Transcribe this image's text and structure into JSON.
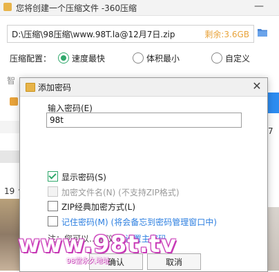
{
  "main_window": {
    "title": "您将创建一个压缩文件 -360压缩",
    "min_glyph": "—",
    "path": "D:\\压缩\\98压缩\\www.98T.la@12月7日.zip",
    "remaining": "剩余:3.6GB",
    "compress_config_label": "压缩配置：",
    "options": [
      "速度最快",
      "体积最小",
      "自定义"
    ],
    "selected_option": "速度最快",
    "partial_label_left": "智",
    "count_fragment": "19 ^",
    "right_fragment": "7"
  },
  "dialog": {
    "title": "添加密码",
    "password_label": "输入密码(E)",
    "password_value": "98t",
    "checkboxes": [
      {
        "label": "显示密码(S)",
        "checked": true,
        "disabled": false
      },
      {
        "label": "加密文件名(N) (不支持ZIP格式)",
        "checked": false,
        "disabled": true
      },
      {
        "label": "ZIP经典加密方式(L)",
        "checked": false,
        "disabled": false
      },
      {
        "label": "记住密码(M) (将会备忘到密码管理窗口中)",
        "checked": false,
        "disabled": false
      }
    ],
    "hint_prefix": "注：您可以…建议先",
    "hint_link": "设置主密码",
    "ok_label": "确认",
    "cancel_label": "取消"
  },
  "watermark": {
    "text": "www.98t.tv",
    "sub": "98堂永久地址"
  },
  "colors": {
    "accent_green": "#2fa86b",
    "link_blue": "#2d7fe0",
    "remain_orange": "#e8a33a",
    "watermark_pink": "#c43ab3"
  }
}
